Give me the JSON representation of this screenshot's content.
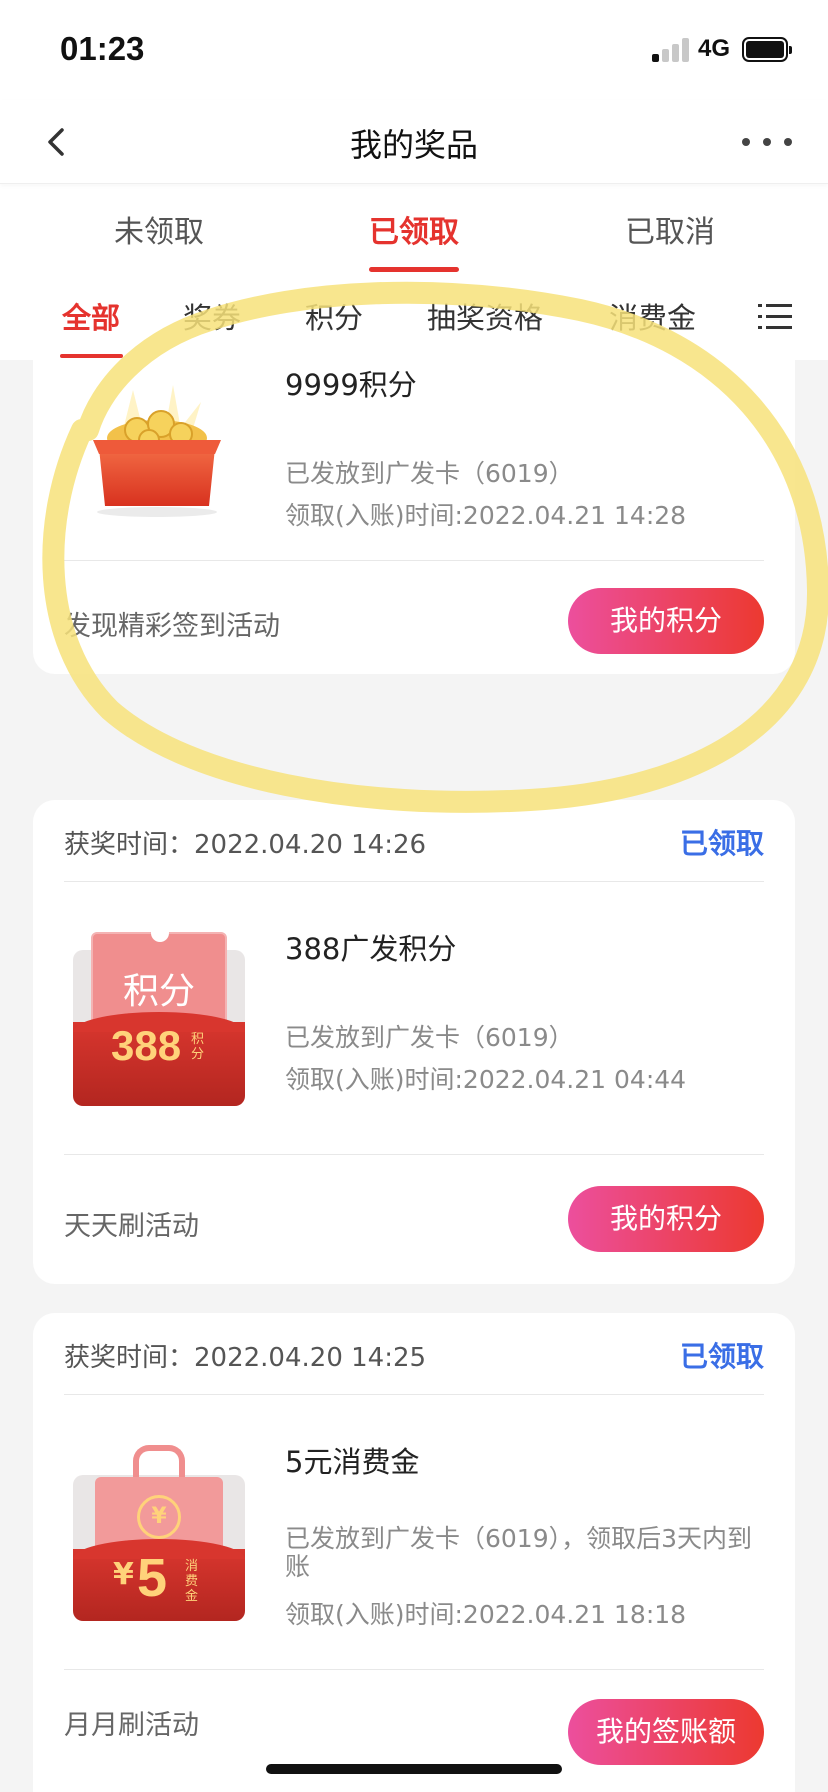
{
  "status_bar": {
    "time": "01:23",
    "network": "4G"
  },
  "header": {
    "title": "我的奖品"
  },
  "tabs": [
    {
      "label": "未领取"
    },
    {
      "label": "已领取"
    },
    {
      "label": "已取消"
    }
  ],
  "active_tab": "已领取",
  "categories": [
    {
      "label": "全部"
    },
    {
      "label": "奖券"
    },
    {
      "label": "积分"
    },
    {
      "label": "抽奖资格"
    },
    {
      "label": "消费金"
    }
  ],
  "active_category": "全部",
  "prizes": [
    {
      "name": "9999积分",
      "desc": "已发放到广发卡（6019）",
      "claim_time": "领取(入账)时间:2022.04.21 14:28",
      "activity": "发现精彩签到活动",
      "button": "我的积分",
      "icon": "gift-box-coins-icon"
    },
    {
      "win_time": "获奖时间：2022.04.20 14:26",
      "status": "已领取",
      "name": "388广发积分",
      "image_label": "积分",
      "image_value": "388",
      "image_unit": "积分",
      "desc": "已发放到广发卡（6019）",
      "claim_time": "领取(入账)时间:2022.04.21 04:44",
      "activity": "天天刷活动",
      "button": "我的积分",
      "icon": "points-coupon-icon"
    },
    {
      "win_time": "获奖时间：2022.04.20 14:25",
      "status": "已领取",
      "name": "5元消费金",
      "image_symbol": "¥",
      "image_value": "5",
      "image_unit": "消费金",
      "desc": "已发放到广发卡（6019），领取后3天内到账",
      "claim_time": "领取(入账)时间:2022.04.21 18:18",
      "activity": "月月刷活动",
      "button": "我的签账额",
      "icon": "shopping-bag-icon"
    }
  ],
  "colors": {
    "accent_red": "#e5332e",
    "claimed_blue": "#3a6ee6",
    "button_gradient_start": "#ec4f9d",
    "button_gradient_end": "#ec3930",
    "highlight_yellow": "#f7e27a"
  }
}
